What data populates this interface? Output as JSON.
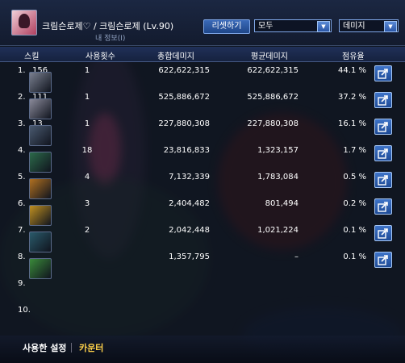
{
  "header": {
    "character_name": "크림슨로제♡ / 크림슨로제 (Lv.90)",
    "sub_info": "내 정보(I)",
    "reset_label": "리셋하기",
    "filter_select": "모두",
    "metric_select": "데미지"
  },
  "columns": {
    "skill": "스킬",
    "uses": "사용횟수",
    "total": "총합데미지",
    "avg": "평균데미지",
    "share": "점유율"
  },
  "rows": [
    {
      "rank": "1.",
      "num": "156",
      "uses": "1",
      "total": "622,622,315",
      "avg": "622,622,315",
      "share": "44.1 %",
      "icon": "slash-skill-icon",
      "color": "#7a8090"
    },
    {
      "rank": "2.",
      "num": "111",
      "uses": "1",
      "total": "525,886,672",
      "avg": "525,886,672",
      "share": "37.2 %",
      "icon": "blade-skill-icon",
      "color": "#8a8a9a"
    },
    {
      "rank": "3.",
      "num": "13",
      "uses": "1",
      "total": "227,880,308",
      "avg": "227,880,308",
      "share": "16.1 %",
      "icon": "summon-skill-icon",
      "color": "#4a5a70"
    },
    {
      "rank": "4.",
      "num": "",
      "uses": "18",
      "total": "23,816,833",
      "avg": "1,323,157",
      "share": "1.7 %",
      "icon": "green-arc-skill-icon",
      "color": "#2c6a4a"
    },
    {
      "rank": "5.",
      "num": "",
      "uses": "4",
      "total": "7,132,339",
      "avg": "1,783,084",
      "share": "0.5 %",
      "icon": "lightning-skill-icon",
      "color": "#b07020"
    },
    {
      "rank": "6.",
      "num": "",
      "uses": "3",
      "total": "2,404,482",
      "avg": "801,494",
      "share": "0.2 %",
      "icon": "golden-orb-skill-icon",
      "color": "#c09020"
    },
    {
      "rank": "7.",
      "num": "",
      "uses": "2",
      "total": "2,042,448",
      "avg": "1,021,224",
      "share": "0.1 %",
      "icon": "dash-skill-icon",
      "color": "#2a5a6a"
    },
    {
      "rank": "8.",
      "num": "",
      "uses": "",
      "total": "1,357,795",
      "avg": "–",
      "share": "0.1 %",
      "icon": "green-burst-skill-icon",
      "color": "#3a8a3a"
    },
    {
      "rank": "9.",
      "num": "",
      "uses": "",
      "total": "",
      "avg": "",
      "share": "",
      "icon": "",
      "color": ""
    },
    {
      "rank": "10.",
      "num": "",
      "uses": "",
      "total": "",
      "avg": "",
      "share": "",
      "icon": "",
      "color": ""
    }
  ],
  "footer": {
    "settings_tab": "사용한 설정",
    "counter_tab": "카운터"
  }
}
